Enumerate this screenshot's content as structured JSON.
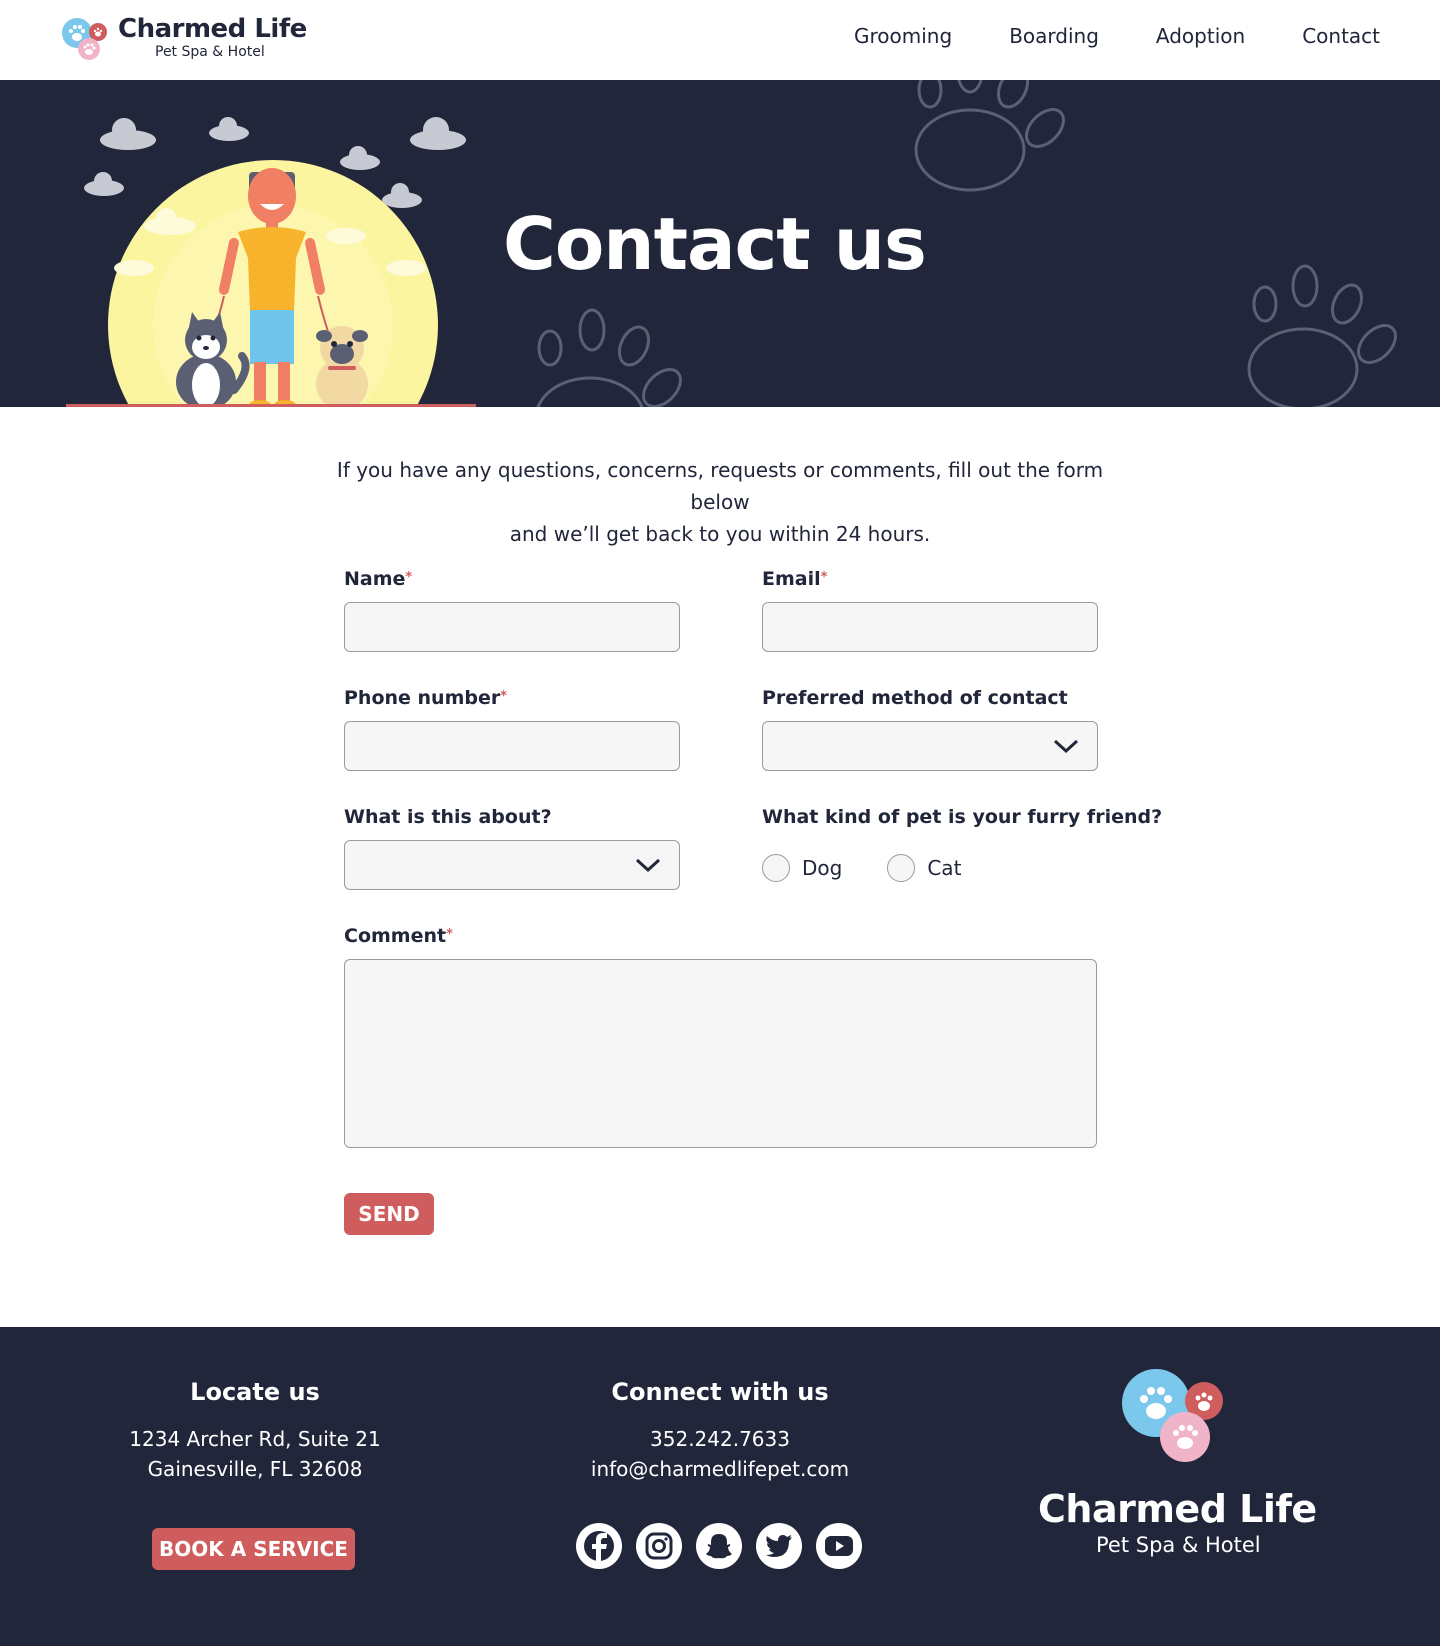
{
  "header": {
    "logo_name": "Charmed Life",
    "logo_tagline": "Pet Spa & Hotel",
    "nav": [
      "Grooming",
      "Boarding",
      "Adoption",
      "Contact"
    ]
  },
  "hero": {
    "title": "Contact us"
  },
  "intro": {
    "line1": "If you have any questions, concerns, requests or comments, fill out the form below",
    "line2": "and we’ll get back to you within 24 hours."
  },
  "form": {
    "name_label": "Name",
    "email_label": "Email",
    "phone_label": "Phone number",
    "preferred_label": "Preferred method of contact",
    "about_label": "What is this about?",
    "pet_label": "What kind of pet is your furry friend?",
    "pet_options": [
      "Dog",
      "Cat"
    ],
    "comment_label": "Comment",
    "required_mark": "*",
    "send_label": "SEND"
  },
  "footer": {
    "locate_heading": "Locate us",
    "address_line1": "1234 Archer Rd, Suite 21",
    "address_line2": "Gainesville, FL 32608",
    "book_label": "BOOK A SERVICE",
    "connect_heading": "Connect with us",
    "phone": "352.242.7633",
    "email": "info@charmedlifepet.com",
    "socials": [
      "facebook-icon",
      "instagram-icon",
      "snapchat-icon",
      "twitter-icon",
      "youtube-icon"
    ],
    "logo_name": "Charmed Life",
    "logo_tagline": "Pet Spa & Hotel"
  },
  "colors": {
    "navy": "#22263b",
    "accent_red": "#d05d5d",
    "paw_blue": "#7cc8ec",
    "paw_pink": "#f0b4c8",
    "input_bg": "#f6f6f6"
  }
}
